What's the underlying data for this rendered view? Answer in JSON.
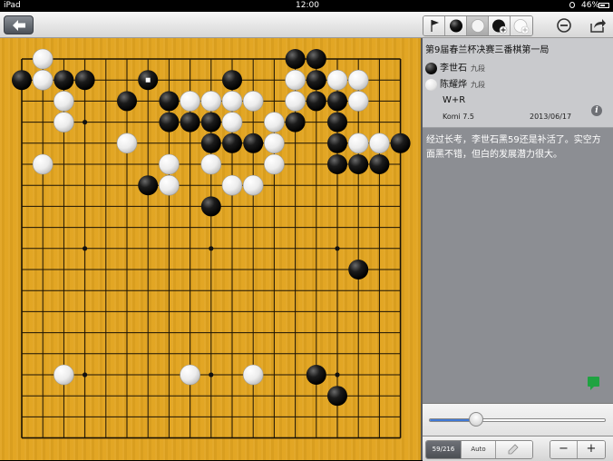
{
  "status_bar": {
    "device": "iPad",
    "time": "12:00",
    "battery": "46%"
  },
  "toolbar": {
    "tools": [
      {
        "name": "flag-icon"
      },
      {
        "name": "black-stone-icon"
      },
      {
        "name": "white-stone-icon"
      },
      {
        "name": "add-black-stone-icon"
      },
      {
        "name": "add-white-stone-icon"
      }
    ],
    "active_tool": 2
  },
  "game": {
    "title": "第9届春兰杯决赛三番棋第一局",
    "black_player": "李世石",
    "black_rank": "九段",
    "white_player": "陈耀烨",
    "white_rank": "九段",
    "result": "W+R",
    "komi": "Komi 7.5",
    "date": "2013/06/17"
  },
  "comment": "经过长考，李世石黑59还是补活了。实空方面黑不错，但白的发展潜力很大。",
  "navigation": {
    "progress": 0.2685,
    "move_counter": "59/216",
    "auto_label": "Auto",
    "minus_label": "−",
    "plus_label": "+"
  },
  "board": {
    "size": 19,
    "star_points": [
      [
        3,
        3
      ],
      [
        3,
        9
      ],
      [
        3,
        15
      ],
      [
        9,
        3
      ],
      [
        9,
        9
      ],
      [
        9,
        15
      ],
      [
        15,
        3
      ],
      [
        15,
        9
      ],
      [
        15,
        15
      ]
    ],
    "last_move": [
      6,
      1
    ],
    "black": [
      [
        0,
        1
      ],
      [
        2,
        1
      ],
      [
        3,
        1
      ],
      [
        6,
        1
      ],
      [
        10,
        1
      ],
      [
        13,
        0
      ],
      [
        14,
        0
      ],
      [
        14,
        1
      ],
      [
        5,
        2
      ],
      [
        7,
        2
      ],
      [
        14,
        2
      ],
      [
        15,
        2
      ],
      [
        7,
        3
      ],
      [
        8,
        3
      ],
      [
        9,
        3
      ],
      [
        13,
        3
      ],
      [
        15,
        3
      ],
      [
        9,
        4
      ],
      [
        10,
        4
      ],
      [
        11,
        4
      ],
      [
        15,
        4
      ],
      [
        18,
        4
      ],
      [
        15,
        5
      ],
      [
        16,
        5
      ],
      [
        17,
        5
      ],
      [
        6,
        6
      ],
      [
        9,
        7
      ],
      [
        16,
        10
      ],
      [
        14,
        15
      ],
      [
        15,
        16
      ]
    ],
    "white": [
      [
        1,
        0
      ],
      [
        1,
        1
      ],
      [
        13,
        1
      ],
      [
        15,
        1
      ],
      [
        16,
        1
      ],
      [
        2,
        2
      ],
      [
        8,
        2
      ],
      [
        9,
        2
      ],
      [
        10,
        2
      ],
      [
        11,
        2
      ],
      [
        13,
        2
      ],
      [
        16,
        2
      ],
      [
        2,
        3
      ],
      [
        10,
        3
      ],
      [
        12,
        3
      ],
      [
        5,
        4
      ],
      [
        12,
        4
      ],
      [
        16,
        4
      ],
      [
        17,
        4
      ],
      [
        1,
        5
      ],
      [
        7,
        5
      ],
      [
        9,
        5
      ],
      [
        12,
        5
      ],
      [
        7,
        6
      ],
      [
        10,
        6
      ],
      [
        11,
        6
      ],
      [
        2,
        15
      ],
      [
        8,
        15
      ],
      [
        11,
        15
      ]
    ]
  }
}
